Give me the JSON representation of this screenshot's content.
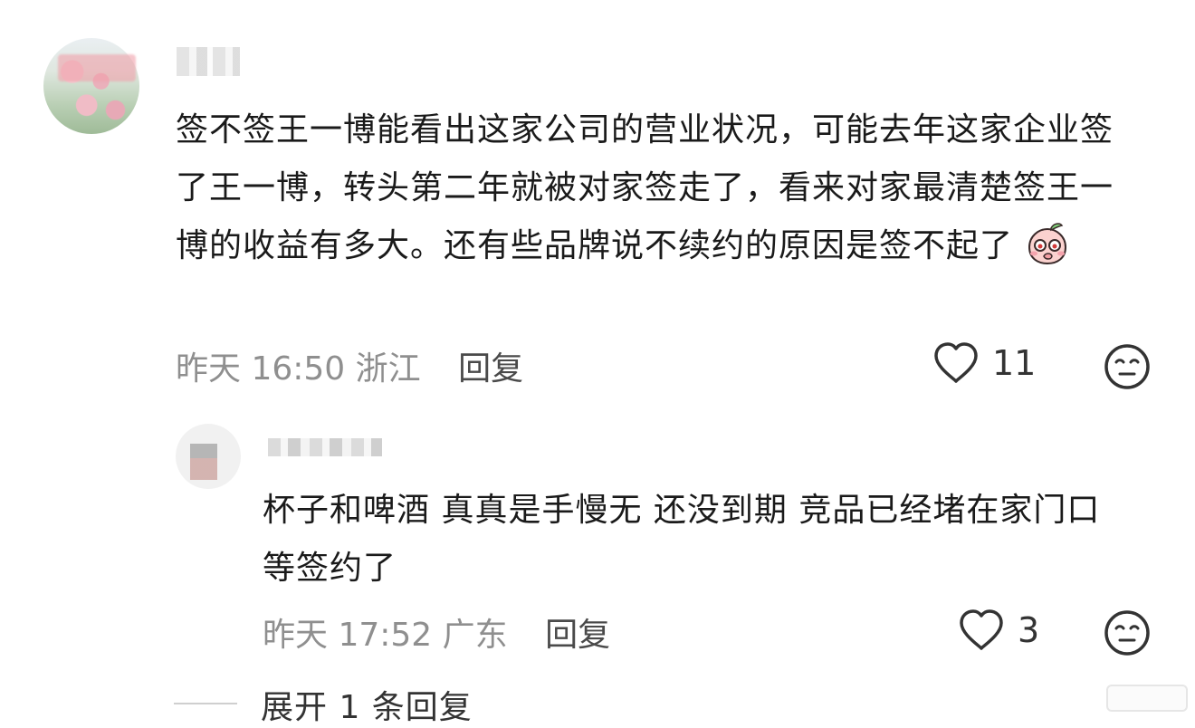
{
  "main_comment": {
    "text": "签不签王一博能看出这家公司的营业状况，可能去年这家企业签了王一博，转头第二年就被对家签走了，看来对家最清楚签王一博的收益有多大。还有些品牌说不续约的原因是签不起了",
    "emoji": "peach-blush-emoji",
    "time_location": "昨天 16:50 浙江",
    "reply_label": "回复",
    "likes": "11"
  },
  "reply_comment": {
    "text": "杯子和啤酒 真真是手慢无 还没到期 竞品已经堵在家门口等签约了",
    "time_location": "昨天 17:52 广东",
    "reply_label": "回复",
    "likes": "3"
  },
  "expand": {
    "label": "展开 1 条回复"
  },
  "icons": {
    "like": "heart-outline-icon",
    "dislike": "neutral-face-icon"
  }
}
